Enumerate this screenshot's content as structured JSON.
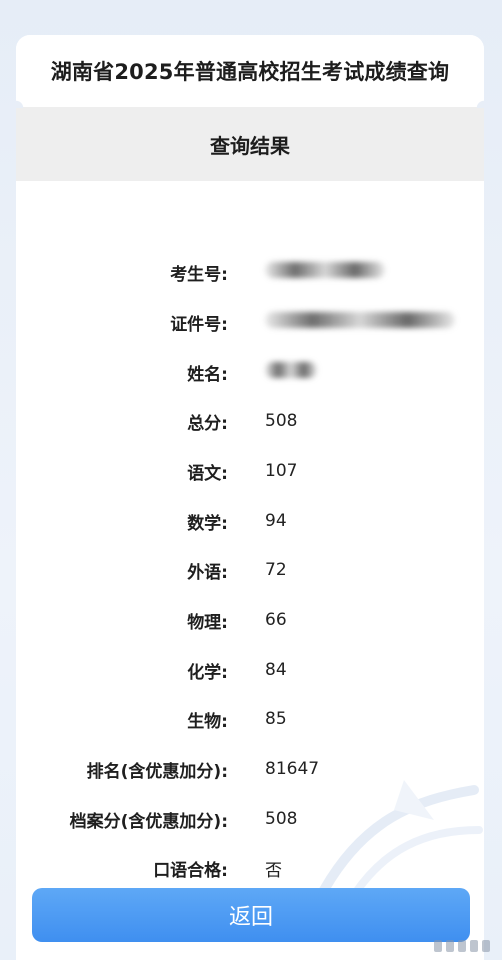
{
  "page": {
    "title": "湖南省2025年普通高校招生考试成绩查询",
    "section_title": "查询结果",
    "return_label": "返回"
  },
  "results": [
    {
      "label": "考生号:",
      "value": "",
      "redacted": true
    },
    {
      "label": "证件号:",
      "value": "",
      "redacted": true
    },
    {
      "label": "姓名:",
      "value": "",
      "redacted": true
    },
    {
      "label": "总分:",
      "value": "508"
    },
    {
      "label": "语文:",
      "value": "107"
    },
    {
      "label": "数学:",
      "value": "94"
    },
    {
      "label": "外语:",
      "value": "72"
    },
    {
      "label": "物理:",
      "value": "66"
    },
    {
      "label": "化学:",
      "value": "84"
    },
    {
      "label": "生物:",
      "value": "85"
    },
    {
      "label": "排名(含优惠加分):",
      "value": "81647"
    },
    {
      "label": "档案分(含优惠加分):",
      "value": "508"
    },
    {
      "label": "口语合格:",
      "value": "否"
    }
  ],
  "colors": {
    "accent": "#4a99f3",
    "page_bg": "#e8eef7",
    "header_bg": "#eeeeee"
  }
}
